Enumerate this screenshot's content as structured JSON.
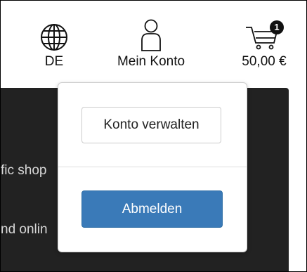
{
  "header": {
    "language": {
      "label": "DE",
      "icon": "globe-icon"
    },
    "account": {
      "label": "Mein Konto",
      "icon": "user-icon"
    },
    "cart": {
      "total": "50,00 €",
      "count": "1",
      "icon": "cart-icon"
    }
  },
  "background": {
    "line1": "fic shop",
    "line2": "nd onlin"
  },
  "account_menu": {
    "manage_label": "Konto verwalten",
    "logout_label": "Abmelden"
  },
  "colors": {
    "primary": "#3a7ab8",
    "dark_panel": "#222222",
    "badge": "#111111"
  }
}
